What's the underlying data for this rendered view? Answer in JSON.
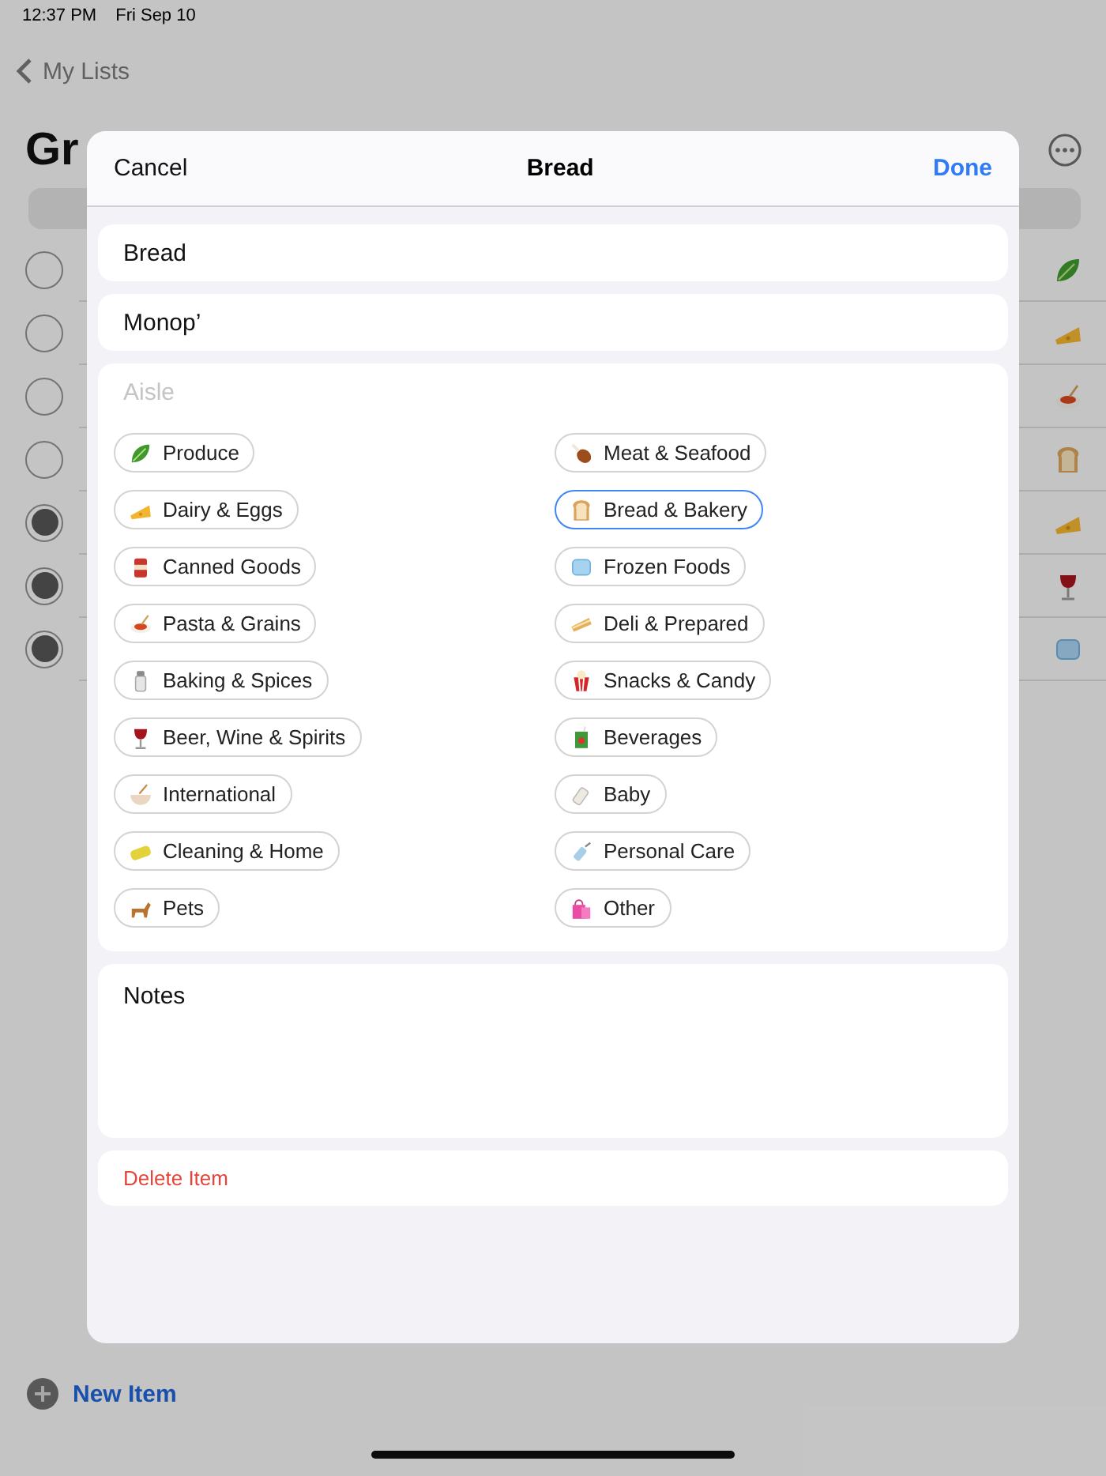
{
  "status_bar": {
    "time": "12:37 PM",
    "date": "Fri Sep 10"
  },
  "background": {
    "back_label": "My Lists",
    "title": "Gr",
    "rows": [
      {
        "checked": false
      },
      {
        "checked": false
      },
      {
        "checked": false
      },
      {
        "checked": false
      },
      {
        "checked": true
      },
      {
        "checked": true
      },
      {
        "checked": true
      }
    ],
    "new_item": "New Item"
  },
  "sheet": {
    "cancel": "Cancel",
    "title": "Bread",
    "done": "Done",
    "name": "Bread",
    "store": "Monop’",
    "aisle": {
      "placeholder": "Aisle",
      "options": [
        {
          "label": "Produce",
          "selected": false
        },
        {
          "label": "Meat & Seafood",
          "selected": false
        },
        {
          "label": "Dairy & Eggs",
          "selected": false
        },
        {
          "label": "Bread & Bakery",
          "selected": true
        },
        {
          "label": "Canned Goods",
          "selected": false
        },
        {
          "label": "Frozen Foods",
          "selected": false
        },
        {
          "label": "Pasta & Grains",
          "selected": false
        },
        {
          "label": "Deli & Prepared",
          "selected": false
        },
        {
          "label": "Baking & Spices",
          "selected": false
        },
        {
          "label": "Snacks & Candy",
          "selected": false
        },
        {
          "label": "Beer, Wine & Spirits",
          "selected": false
        },
        {
          "label": "Beverages",
          "selected": false
        },
        {
          "label": "International",
          "selected": false
        },
        {
          "label": "Baby",
          "selected": false
        },
        {
          "label": "Cleaning & Home",
          "selected": false
        },
        {
          "label": "Personal Care",
          "selected": false
        },
        {
          "label": "Pets",
          "selected": false
        },
        {
          "label": "Other",
          "selected": false
        }
      ]
    },
    "notes": "Notes",
    "delete": "Delete Item"
  }
}
